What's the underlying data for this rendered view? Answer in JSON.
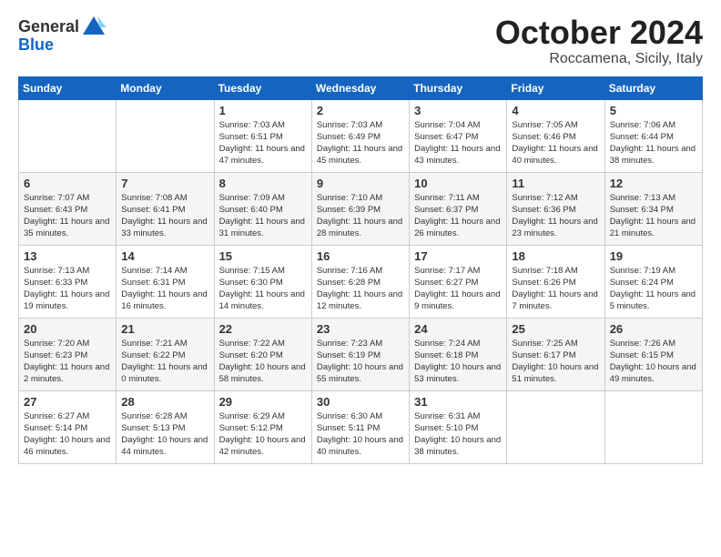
{
  "header": {
    "logo_general": "General",
    "logo_blue": "Blue",
    "month_title": "October 2024",
    "location": "Roccamena, Sicily, Italy"
  },
  "calendar": {
    "days_of_week": [
      "Sunday",
      "Monday",
      "Tuesday",
      "Wednesday",
      "Thursday",
      "Friday",
      "Saturday"
    ],
    "weeks": [
      [
        {
          "day": "",
          "info": ""
        },
        {
          "day": "",
          "info": ""
        },
        {
          "day": "1",
          "info": "Sunrise: 7:03 AM\nSunset: 6:51 PM\nDaylight: 11 hours and 47 minutes."
        },
        {
          "day": "2",
          "info": "Sunrise: 7:03 AM\nSunset: 6:49 PM\nDaylight: 11 hours and 45 minutes."
        },
        {
          "day": "3",
          "info": "Sunrise: 7:04 AM\nSunset: 6:47 PM\nDaylight: 11 hours and 43 minutes."
        },
        {
          "day": "4",
          "info": "Sunrise: 7:05 AM\nSunset: 6:46 PM\nDaylight: 11 hours and 40 minutes."
        },
        {
          "day": "5",
          "info": "Sunrise: 7:06 AM\nSunset: 6:44 PM\nDaylight: 11 hours and 38 minutes."
        }
      ],
      [
        {
          "day": "6",
          "info": "Sunrise: 7:07 AM\nSunset: 6:43 PM\nDaylight: 11 hours and 35 minutes."
        },
        {
          "day": "7",
          "info": "Sunrise: 7:08 AM\nSunset: 6:41 PM\nDaylight: 11 hours and 33 minutes."
        },
        {
          "day": "8",
          "info": "Sunrise: 7:09 AM\nSunset: 6:40 PM\nDaylight: 11 hours and 31 minutes."
        },
        {
          "day": "9",
          "info": "Sunrise: 7:10 AM\nSunset: 6:39 PM\nDaylight: 11 hours and 28 minutes."
        },
        {
          "day": "10",
          "info": "Sunrise: 7:11 AM\nSunset: 6:37 PM\nDaylight: 11 hours and 26 minutes."
        },
        {
          "day": "11",
          "info": "Sunrise: 7:12 AM\nSunset: 6:36 PM\nDaylight: 11 hours and 23 minutes."
        },
        {
          "day": "12",
          "info": "Sunrise: 7:13 AM\nSunset: 6:34 PM\nDaylight: 11 hours and 21 minutes."
        }
      ],
      [
        {
          "day": "13",
          "info": "Sunrise: 7:13 AM\nSunset: 6:33 PM\nDaylight: 11 hours and 19 minutes."
        },
        {
          "day": "14",
          "info": "Sunrise: 7:14 AM\nSunset: 6:31 PM\nDaylight: 11 hours and 16 minutes."
        },
        {
          "day": "15",
          "info": "Sunrise: 7:15 AM\nSunset: 6:30 PM\nDaylight: 11 hours and 14 minutes."
        },
        {
          "day": "16",
          "info": "Sunrise: 7:16 AM\nSunset: 6:28 PM\nDaylight: 11 hours and 12 minutes."
        },
        {
          "day": "17",
          "info": "Sunrise: 7:17 AM\nSunset: 6:27 PM\nDaylight: 11 hours and 9 minutes."
        },
        {
          "day": "18",
          "info": "Sunrise: 7:18 AM\nSunset: 6:26 PM\nDaylight: 11 hours and 7 minutes."
        },
        {
          "day": "19",
          "info": "Sunrise: 7:19 AM\nSunset: 6:24 PM\nDaylight: 11 hours and 5 minutes."
        }
      ],
      [
        {
          "day": "20",
          "info": "Sunrise: 7:20 AM\nSunset: 6:23 PM\nDaylight: 11 hours and 2 minutes."
        },
        {
          "day": "21",
          "info": "Sunrise: 7:21 AM\nSunset: 6:22 PM\nDaylight: 11 hours and 0 minutes."
        },
        {
          "day": "22",
          "info": "Sunrise: 7:22 AM\nSunset: 6:20 PM\nDaylight: 10 hours and 58 minutes."
        },
        {
          "day": "23",
          "info": "Sunrise: 7:23 AM\nSunset: 6:19 PM\nDaylight: 10 hours and 55 minutes."
        },
        {
          "day": "24",
          "info": "Sunrise: 7:24 AM\nSunset: 6:18 PM\nDaylight: 10 hours and 53 minutes."
        },
        {
          "day": "25",
          "info": "Sunrise: 7:25 AM\nSunset: 6:17 PM\nDaylight: 10 hours and 51 minutes."
        },
        {
          "day": "26",
          "info": "Sunrise: 7:26 AM\nSunset: 6:15 PM\nDaylight: 10 hours and 49 minutes."
        }
      ],
      [
        {
          "day": "27",
          "info": "Sunrise: 6:27 AM\nSunset: 5:14 PM\nDaylight: 10 hours and 46 minutes."
        },
        {
          "day": "28",
          "info": "Sunrise: 6:28 AM\nSunset: 5:13 PM\nDaylight: 10 hours and 44 minutes."
        },
        {
          "day": "29",
          "info": "Sunrise: 6:29 AM\nSunset: 5:12 PM\nDaylight: 10 hours and 42 minutes."
        },
        {
          "day": "30",
          "info": "Sunrise: 6:30 AM\nSunset: 5:11 PM\nDaylight: 10 hours and 40 minutes."
        },
        {
          "day": "31",
          "info": "Sunrise: 6:31 AM\nSunset: 5:10 PM\nDaylight: 10 hours and 38 minutes."
        },
        {
          "day": "",
          "info": ""
        },
        {
          "day": "",
          "info": ""
        }
      ]
    ]
  }
}
